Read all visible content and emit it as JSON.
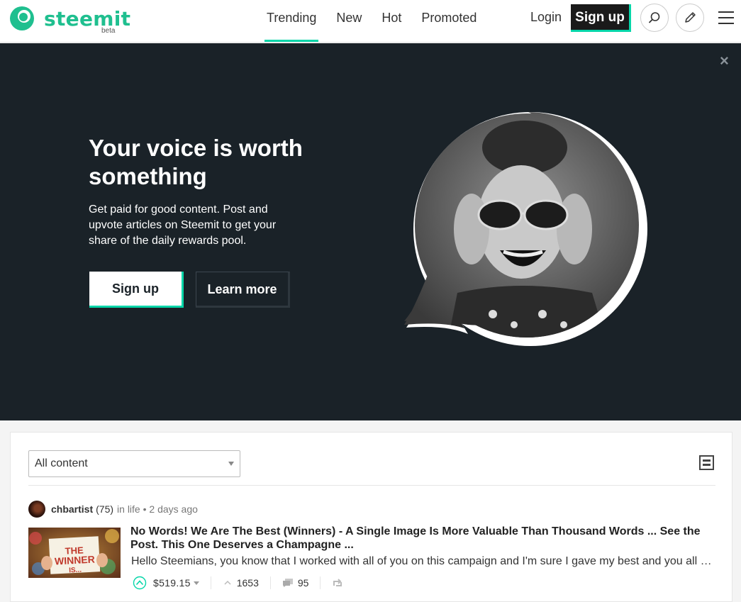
{
  "header": {
    "logo_text": "steemit",
    "logo_badge": "beta",
    "nav": [
      {
        "label": "Trending",
        "active": true
      },
      {
        "label": "New",
        "active": false
      },
      {
        "label": "Hot",
        "active": false
      },
      {
        "label": "Promoted",
        "active": false
      }
    ],
    "login_label": "Login",
    "signup_label": "Sign up",
    "icons": [
      "search-icon",
      "pencil-icon",
      "hamburger-menu-icon"
    ]
  },
  "hero": {
    "close_label": "×",
    "title": "Your voice is worth something",
    "text": "Get paid for good content. Post and upvote articles on Steemit to get your share of the daily rewards pool.",
    "signup_label": "Sign up",
    "learn_more_label": "Learn more"
  },
  "feed": {
    "filter": {
      "selected": "All content"
    },
    "post": {
      "author": "chbartist",
      "reputation": "(75)",
      "meta": "in life • 2 days ago",
      "thumbnail_text": "THE WINNER IS...",
      "title": "No Words! We Are The Best (Winners) - A Single Image Is More Valuable Than Thousand Words ... See the Post. This One Deserves a Champagne ...",
      "excerpt": "Hello Steemians, you know that I worked with all of you on this campaign and I'm sure I gave my best and you all …",
      "payout": "$519.15",
      "votes": "1653",
      "comments": "95"
    }
  },
  "colors": {
    "accent": "#06d6a9",
    "brand": "#1fbf8f",
    "hero_bg": "#1a2228",
    "button_dark": "#1a1a1a"
  }
}
